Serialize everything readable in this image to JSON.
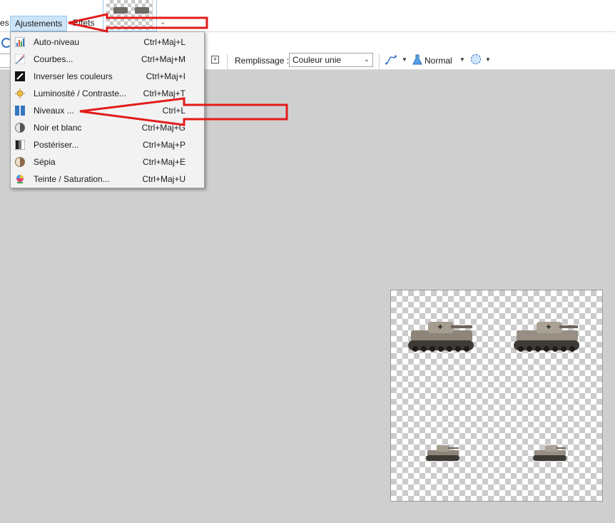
{
  "menubar": {
    "prev_label": "es",
    "adjustments_label": "Ajustements",
    "next_label": "Effets"
  },
  "toolbar": {
    "fill_label": "Remplissage :",
    "fill_value": "Couleur unie",
    "blend_mode": "Normal"
  },
  "menu": {
    "items": [
      {
        "label": "Auto-niveau",
        "shortcut": "Ctrl+Maj+L",
        "icon": "auto-level-icon"
      },
      {
        "label": "Courbes...",
        "shortcut": "Ctrl+Maj+M",
        "icon": "curves-icon"
      },
      {
        "label": "Inverser les couleurs",
        "shortcut": "Ctrl+Maj+I",
        "icon": "invert-colors-icon"
      },
      {
        "label": "Luminosité / Contraste...",
        "shortcut": "Ctrl+Maj+T",
        "icon": "brightness-contrast-icon"
      },
      {
        "label": "Niveaux ...",
        "shortcut": "Ctrl+L",
        "icon": "levels-icon"
      },
      {
        "label": "Noir et blanc",
        "shortcut": "Ctrl+Maj+G",
        "icon": "black-white-icon"
      },
      {
        "label": "Postériser...",
        "shortcut": "Ctrl+Maj+P",
        "icon": "posterize-icon"
      },
      {
        "label": "Sépia",
        "shortcut": "Ctrl+Maj+E",
        "icon": "sepia-icon"
      },
      {
        "label": "Teinte / Saturation...",
        "shortcut": "Ctrl+Maj+U",
        "icon": "hue-saturation-icon"
      }
    ]
  },
  "colors": {
    "menu_highlight": "#cce4f7",
    "annotation_arrow": "#e21b1b",
    "workspace": "#cfcfcf"
  }
}
